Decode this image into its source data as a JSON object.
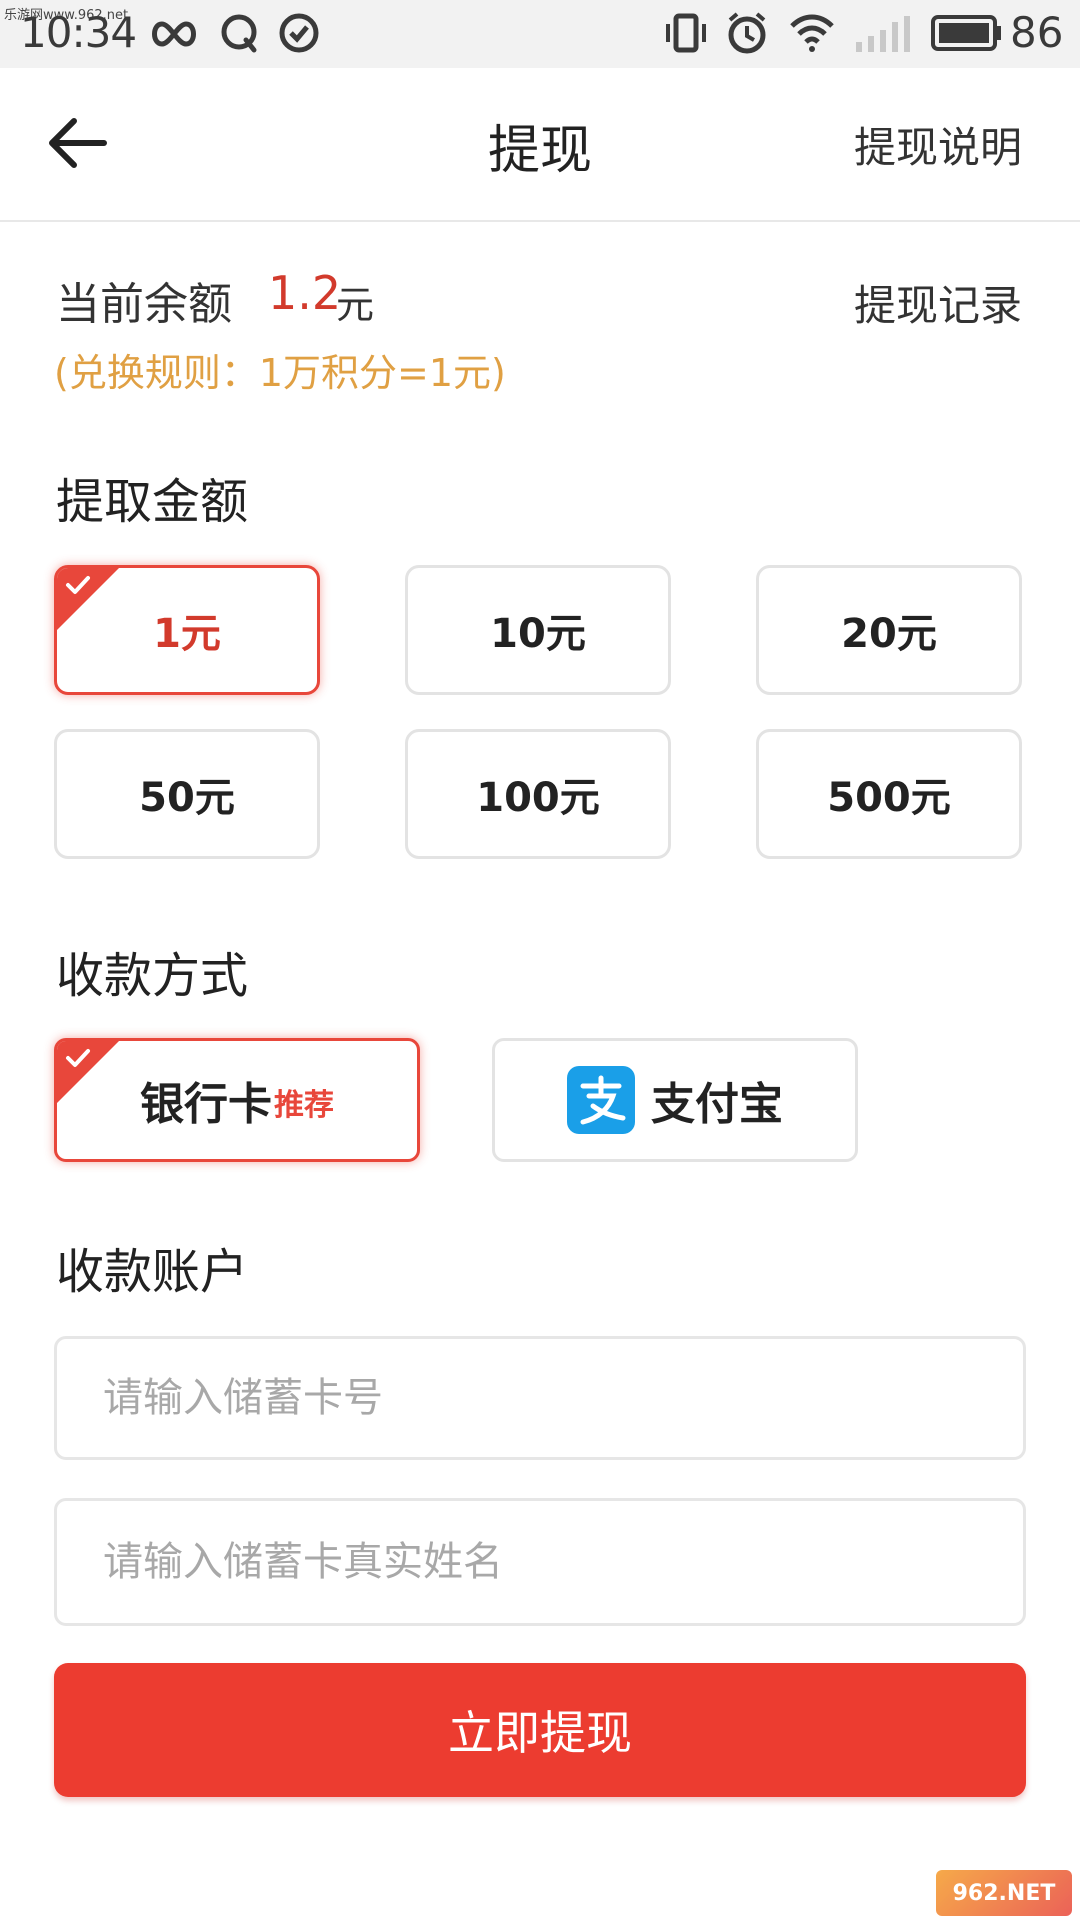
{
  "status_bar": {
    "watermark": "乐游网www.962.net",
    "time": "10:34",
    "battery": "86"
  },
  "header": {
    "title": "提现",
    "help_link": "提现说明"
  },
  "balance": {
    "label": "当前余额",
    "value": "1.2",
    "unit": "元",
    "records_link": "提现记录",
    "rule": "(兑换规则：1万积分=1元)"
  },
  "amount_section": {
    "title": "提取金额",
    "options": [
      "1元",
      "10元",
      "20元",
      "50元",
      "100元",
      "500元"
    ],
    "selected_index": 0
  },
  "payment_section": {
    "title": "收款方式",
    "methods": [
      {
        "label": "银行卡",
        "tag": "推荐"
      },
      {
        "label": "支付宝",
        "tag": ""
      }
    ],
    "selected_index": 0
  },
  "account_section": {
    "title": "收款账户",
    "card_number_placeholder": "请输入储蓄卡号",
    "card_number_value": "",
    "name_placeholder": "请输入储蓄卡真实姓名",
    "name_value": ""
  },
  "submit_label": "立即提现",
  "watermark_bottom": "962.NET",
  "colors": {
    "accent": "#e8473b",
    "price": "#d23a2c",
    "rule": "#e0a043",
    "button": "#ec3c30",
    "alipay": "#1a9fe8"
  }
}
